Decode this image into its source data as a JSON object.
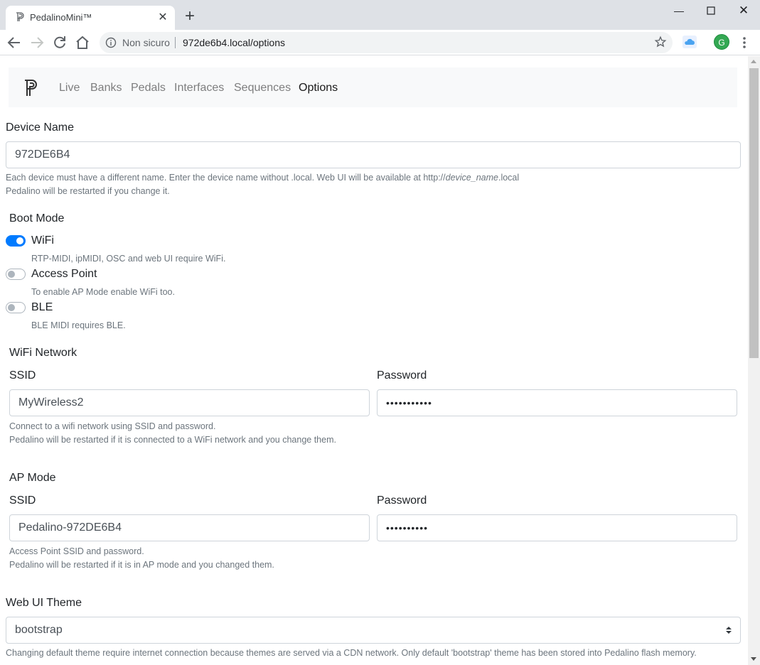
{
  "browser": {
    "tab_title": "PedalinoMini™",
    "security_label": "Non sicuro",
    "url": "972de6b4.local/options",
    "avatar_letter": "G"
  },
  "nav": {
    "links": [
      "Live",
      "Banks",
      "Pedals",
      "Interfaces",
      "Sequences",
      "Options"
    ],
    "active": "Options"
  },
  "device": {
    "label": "Device Name",
    "value": "972DE6B4",
    "help_prefix": "Each device must have a different name. Enter the device name without .local. Web UI will be available at http://",
    "help_italic": "device_name",
    "help_suffix": ".local",
    "help_line2": "Pedalino will be restarted if you change it."
  },
  "boot": {
    "title": "Boot Mode",
    "options": [
      {
        "label": "WiFi",
        "enabled": true,
        "help": "RTP-MIDI, ipMIDI, OSC and web UI require WiFi."
      },
      {
        "label": "Access Point",
        "enabled": false,
        "help": "To enable AP Mode enable WiFi too."
      },
      {
        "label": "BLE",
        "enabled": false,
        "help": "BLE MIDI requires BLE."
      }
    ]
  },
  "wifi": {
    "title": "WiFi Network",
    "ssid_label": "SSID",
    "ssid_value": "MyWireless2",
    "password_label": "Password",
    "password_value": "•••••••••••",
    "help_line1": "Connect to a wifi network using SSID and password.",
    "help_line2": "Pedalino will be restarted if it is connected to a WiFi network and you change them."
  },
  "ap": {
    "title": "AP Mode",
    "ssid_label": "SSID",
    "ssid_value": "Pedalino-972DE6B4",
    "password_label": "Password",
    "password_value": "••••••••••",
    "help_line1": "Access Point SSID and password.",
    "help_line2": "Pedalino will be restarted if it is in AP mode and you changed them."
  },
  "theme": {
    "label": "Web UI Theme",
    "selected": "bootstrap",
    "help": "Changing default theme require internet connection because themes are served via a CDN network. Only default 'bootstrap' theme has been stored into Pedalino flash memory."
  },
  "colors": {
    "accent": "#007bff",
    "navbar_bg": "#f8f9fa",
    "muted": "#6c757d"
  }
}
